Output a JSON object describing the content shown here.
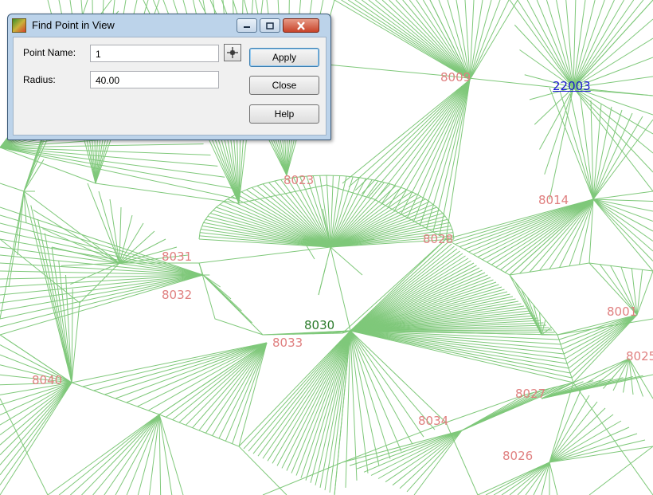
{
  "view": {
    "line_color": "#7fc87a",
    "point_label_color": "#e08080",
    "highlight_label_color": "#2a7a2a",
    "selected_label_color": "#1a1ad0",
    "point_labels": {
      "p8009": "8009",
      "p22003": "22003",
      "p8023": "8023",
      "p8014": "8014",
      "p8028": "8028",
      "p8031": "8031",
      "p8032": "8032",
      "p8030": "8030",
      "p8033": "8033",
      "p8001": "8001",
      "p8025": "8025",
      "p8040": "8040",
      "p8027": "8027",
      "p8034": "8034",
      "p8026": "8026"
    }
  },
  "dialog": {
    "title": "Find Point in View",
    "icon": "app-icon",
    "point_name_label": "Point Name:",
    "point_name_value": "1",
    "radius_label": "Radius:",
    "radius_value": "40.00",
    "pick_icon": "crosshair-icon",
    "apply_label": "Apply",
    "close_label": "Close",
    "help_label": "Help"
  }
}
